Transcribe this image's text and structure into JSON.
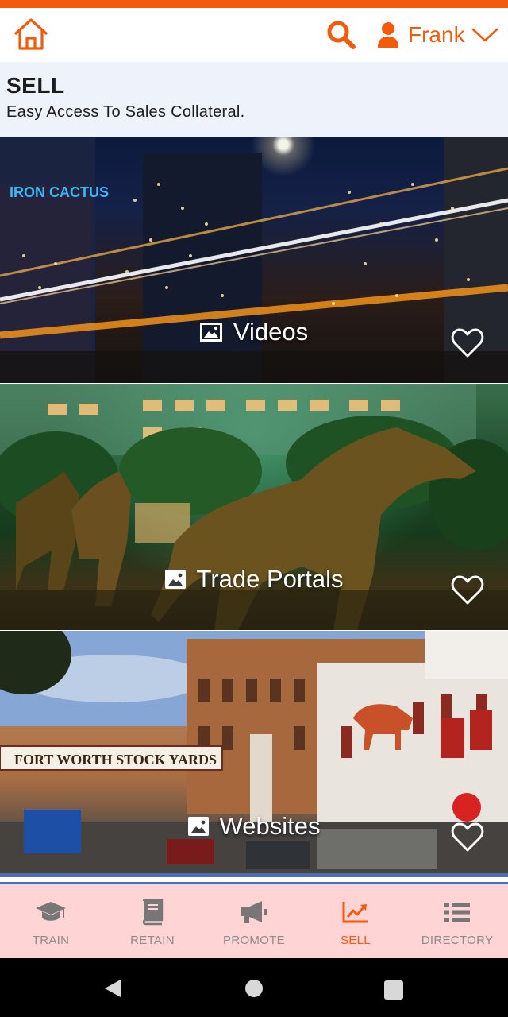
{
  "header": {
    "home_icon": "home-icon",
    "search_icon": "search-icon",
    "user_icon": "person-icon",
    "user_name": "Frank",
    "dropdown_icon": "chevron-down-icon",
    "accent_color": "#f35a0c"
  },
  "page": {
    "title": "SELL",
    "subtitle": "Easy Access To Sales Collateral."
  },
  "cards": [
    {
      "label": "Videos",
      "icon": "image-icon",
      "favorite_icon": "heart-outline-icon"
    },
    {
      "label": "Trade Portals",
      "icon": "image-icon",
      "favorite_icon": "heart-outline-icon"
    },
    {
      "label": "Websites",
      "icon": "image-icon",
      "favorite_icon": "heart-outline-icon"
    }
  ],
  "bottom_nav": {
    "items": [
      {
        "label": "TRAIN",
        "icon": "graduation-cap-icon",
        "active": false
      },
      {
        "label": "RETAIN",
        "icon": "book-icon",
        "active": false
      },
      {
        "label": "PROMOTE",
        "icon": "megaphone-icon",
        "active": false
      },
      {
        "label": "SELL",
        "icon": "trending-up-icon",
        "active": true
      },
      {
        "label": "DIRECTORY",
        "icon": "list-icon",
        "active": false
      }
    ],
    "active_color": "#f35a0c",
    "inactive_color": "#8c8c8c"
  },
  "system_nav": {
    "back_icon": "back-triangle-icon",
    "home_icon": "home-circle-icon",
    "recents_icon": "recents-square-icon"
  }
}
